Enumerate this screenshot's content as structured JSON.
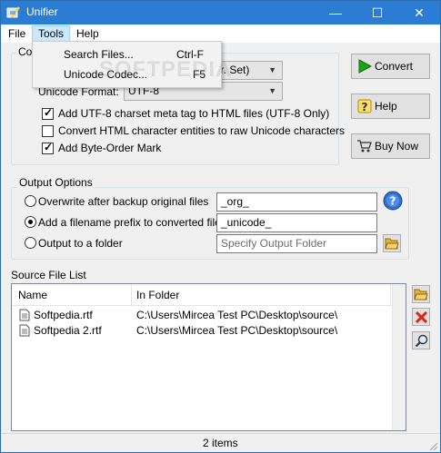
{
  "window": {
    "title": "Unifier",
    "minimize_glyph": "—",
    "maximize_glyph": "☐",
    "close_glyph": "✕"
  },
  "menu": {
    "file": "File",
    "tools": "Tools",
    "help": "Help",
    "tools_items": [
      {
        "label": "Search Files...",
        "shortcut": "Ctrl-F"
      },
      {
        "label": "Unicode Codec...",
        "shortcut": "F5"
      }
    ]
  },
  "conversion": {
    "group_label_visible": "Co",
    "charset_value": "har. Set)",
    "unicode_format_label": "Unicode Format:",
    "unicode_format_value": "UTF-8",
    "options": [
      {
        "label": "Add UTF-8 charset meta tag to HTML files (UTF-8 Only)",
        "checked": true
      },
      {
        "label": "Convert HTML character entities to raw Unicode characters",
        "checked": false
      },
      {
        "label": "Add Byte-Order Mark",
        "checked": true
      }
    ]
  },
  "buttons": {
    "convert": "Convert",
    "help": "Help",
    "buy_now": "Buy Now"
  },
  "output": {
    "group_label": "Output Options",
    "choices": [
      {
        "label": "Overwrite after backup original files",
        "value": "_org_",
        "selected": false
      },
      {
        "label": "Add a filename prefix to converted files",
        "value": "_unicode_",
        "selected": true
      },
      {
        "label": "Output to a folder",
        "placeholder": "Specify Output Folder",
        "selected": false
      }
    ]
  },
  "source_list": {
    "label": "Source File List",
    "columns": [
      "Name",
      "In Folder"
    ],
    "rows": [
      {
        "name": "Softpedia.rtf",
        "folder": "C:\\Users\\Mircea Test PC\\Desktop\\source\\"
      },
      {
        "name": "Softpedia 2.rtf",
        "folder": "C:\\Users\\Mircea Test PC\\Desktop\\source\\"
      }
    ]
  },
  "status": {
    "count": "2 items"
  },
  "watermark": "SOFTPEDIA",
  "colors": {
    "titlebar": "#2b7cd3",
    "menu_active": "#cce8ff",
    "convert_arrow": "#1aa31a",
    "remove_x": "#d9261c",
    "info_icon": "#2f6fcf",
    "folder_icon": "#e8b530"
  },
  "icons": [
    "app-icon",
    "convert-arrow-icon",
    "help-question-icon",
    "cart-icon",
    "info-icon",
    "folder-open-icon",
    "add-folder-icon",
    "remove-icon",
    "search-icon",
    "file-icon"
  ]
}
